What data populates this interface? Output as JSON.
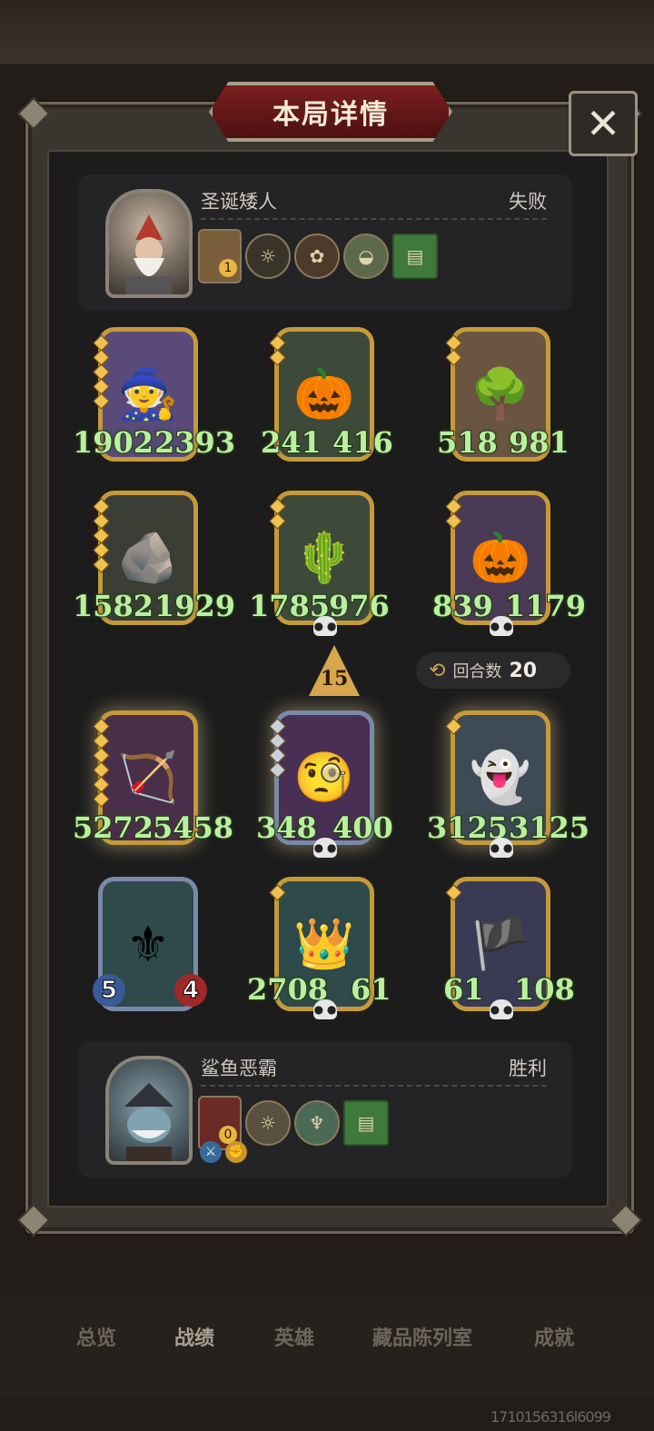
{
  "title": "本局详情",
  "close_icon": "close-icon",
  "opponent": {
    "name": "圣诞矮人",
    "result": "失败",
    "hero_badge": "1",
    "items": [
      "gift-icon",
      "compass-icon",
      "rose-icon",
      "rat-icon",
      "book-icon"
    ]
  },
  "player": {
    "name": "鲨鱼恶霸",
    "result": "胜利",
    "hero_badge": "0",
    "items": [
      "compass-icon",
      "idol-icon",
      "book-icon"
    ],
    "buffs": [
      "sword-buff-icon",
      "strength-buff-icon"
    ]
  },
  "opponent_board": [
    {
      "name": "witch",
      "atk": "1902",
      "hp": "2393"
    },
    {
      "name": "pumpkin",
      "atk": "241",
      "hp": "416"
    },
    {
      "name": "treant",
      "atk": "518",
      "hp": "981"
    },
    {
      "name": "rock",
      "atk": "1582",
      "hp": "1929"
    },
    {
      "name": "cactus",
      "atk": "1785",
      "hp": "976"
    },
    {
      "name": "pumpkin",
      "atk": "839",
      "hp": "1179"
    }
  ],
  "player_board": [
    {
      "name": "hunter",
      "atk": "5272",
      "hp": "5458"
    },
    {
      "name": "professor",
      "atk": "348",
      "hp": "400"
    },
    {
      "name": "ghost",
      "atk": "3125",
      "hp": "3125"
    },
    {
      "name": "paladin",
      "atk": "5",
      "hp": "4"
    },
    {
      "name": "king-ghost",
      "atk": "2708",
      "hp": "61"
    },
    {
      "name": "pirate-ghost",
      "atk": "61",
      "hp": "108"
    }
  ],
  "attack_indicator": "15",
  "round": {
    "label": "回合数",
    "value": "20"
  },
  "tabs": [
    "总览",
    "战绩",
    "英雄",
    "藏品陈列室",
    "成就"
  ],
  "watermark": "1710156316l6099"
}
